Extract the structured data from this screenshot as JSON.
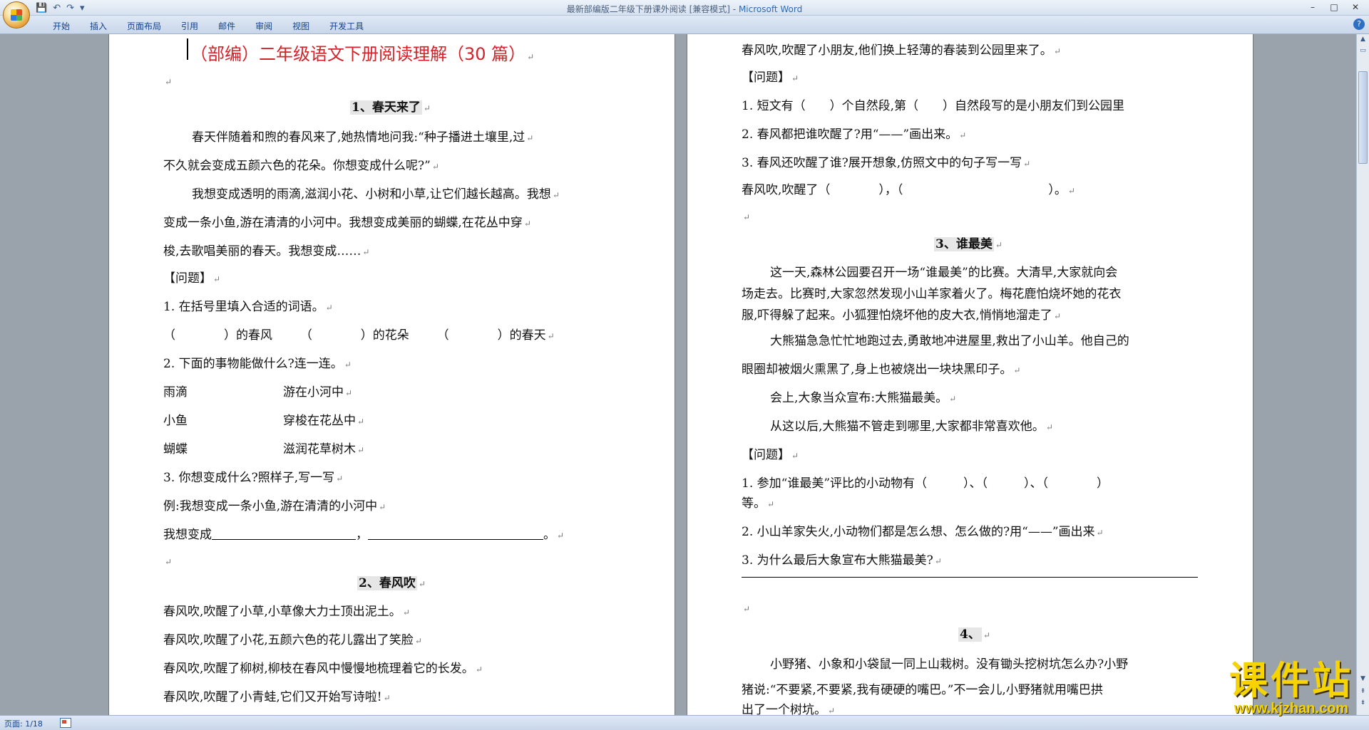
{
  "window": {
    "title_doc": "最新部编版二年级下册课外阅读 [兼容模式] -",
    "title_app": "Microsoft Word"
  },
  "ribbon": {
    "tabs": [
      "开始",
      "插入",
      "页面布局",
      "引用",
      "邮件",
      "审阅",
      "视图",
      "开发工具"
    ]
  },
  "left_page": {
    "title": "（部编）二年级语文下册阅读理解（30 篇）",
    "s1_heading": "1、春天来了",
    "s1_p1a": "春天伴随着和煦的春风来了,她热情地问我:“种子播进土壤里,过",
    "s1_p1b": "不久就会变成五颜六色的花朵。你想变成什么呢?”",
    "s1_p2a": "我想变成透明的雨滴,滋润小花、小树和小草,让它们越长越高。我想",
    "s1_p2b": "变成一条小鱼,游在清清的小河中。我想变成美丽的蝴蝶,在花丛中穿",
    "s1_p2c": "梭,去歌唱美丽的春天。我想变成……",
    "s1_q_label": "【问题】",
    "s1_q1": "1. 在括号里填入合适的词语。",
    "s1_q1_a": "（　　　　）的春风",
    "s1_q1_b": "（　　　　）的花朵",
    "s1_q1_c": "（　　　　）的春天",
    "s1_q2": "2. 下面的事物能做什么?连一连。",
    "s1_q2_rows": [
      {
        "left": "雨滴",
        "right": "游在小河中"
      },
      {
        "left": "小鱼",
        "right": "穿梭在花丛中"
      },
      {
        "left": "蝴蝶",
        "right": "滋润花草树木"
      }
    ],
    "s1_q3": "3. 你想变成什么?照样子,写一写",
    "s1_q3_example": "例:我想变成一条小鱼,游在清清的小河中",
    "s1_q3_answer_prefix": "我想变成",
    "s1_q3_answer_sep": "，",
    "s1_q3_answer_end": "。",
    "s2_heading": "2、春风吹",
    "s2_l1": "春风吹,吹醒了小草,小草像大力士顶出泥土。",
    "s2_l2": "春风吹,吹醒了小花,五颜六色的花儿露出了笑脸",
    "s2_l3": "春风吹,吹醒了柳树,柳枝在春风中慢慢地梳理着它的长发。",
    "s2_l4": "春风吹,吹醒了小青蛙,它们又开始写诗啦!"
  },
  "right_page": {
    "s2_l5": "春风吹,吹醒了小朋友,他们换上轻薄的春装到公园里来了。",
    "s2_q_label": "【问题】",
    "s2_q1": "1. 短文有（　　）个自然段,第（　　）自然段写的是小朋友们到公园里",
    "s2_q2": "2. 春风都把谁吹醒了?用“——”画出来。",
    "s2_q3": "3. 春风还吹醒了谁?展开想象,仿照文中的句子写一写",
    "s2_q3_answer": "春风吹,吹醒了（　　　　），（　　　　　　　　　　　　）。",
    "s3_heading": "3、谁最美",
    "s3_p1a": "这一天,森林公园要召开一场“谁最美”的比赛。大清早,大家就向会",
    "s3_p1b": "场走去。比赛时,大家忽然发现小山羊家着火了。梅花鹿怕烧坏她的花衣",
    "s3_p1c": "服,吓得躲了起来。小狐狸怕烧坏他的皮大衣,悄悄地溜走了",
    "s3_p2a": "大熊猫急急忙忙地跑过去,勇敢地冲进屋里,救出了小山羊。他自己的",
    "s3_p2b": "眼圈却被烟火熏黑了,身上也被烧出一块块黑印子。",
    "s3_p3": "会上,大象当众宣布:大熊猫最美。",
    "s3_p4": "从这以后,大熊猫不管走到哪里,大家都非常喜欢他。",
    "s3_q_label": "【问题】",
    "s3_q1a": "1. 参加“谁最美”评比的小动物有（　　　）、（　　　）、（　　　　）",
    "s3_q1b": "等。",
    "s3_q2": "2. 小山羊家失火,小动物们都是怎么想、怎么做的?用“——”画出来",
    "s3_q3": "3. 为什么最后大象宣布大熊猫最美?",
    "s4_heading": "4、",
    "s4_p1a": "小野猪、小象和小袋鼠一同上山栽树。没有锄头挖树坑怎么办?小野",
    "s4_p1b": "猪说:“不要紧,不要紧,我有硬硬的嘴巴。”不一会儿,小野猪就用嘴巴拱",
    "s4_p1c": "出了一个树坑。"
  },
  "paragraph_mark": "↵",
  "status": {
    "page": "页面: 1/18"
  },
  "watermark": {
    "name": "课件站",
    "url": "www.kjzhan.com"
  }
}
